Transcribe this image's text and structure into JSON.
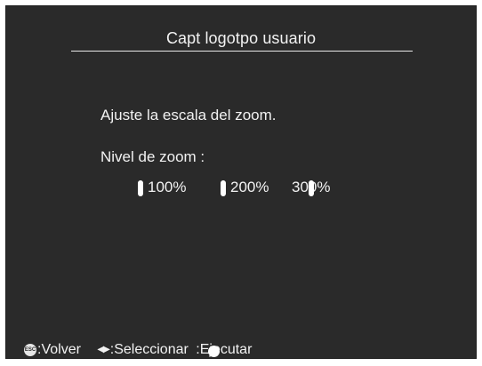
{
  "title": "Capt logotpo usuario",
  "instruction": "Ajuste la escala del zoom.",
  "zoom_label": "Nivel de zoom :",
  "options": [
    {
      "label": "100%"
    },
    {
      "label": "200%"
    },
    {
      "label": "300%"
    }
  ],
  "footer": {
    "back_icon_text": "ESC",
    "back_label": ":Volver",
    "select_icon": "left-right-arrows-icon",
    "select_label": ":Seleccionar",
    "execute_label": ":Ejecutar",
    "execute_icon": "enter-button-icon"
  },
  "colors": {
    "background": "#2a2a2a",
    "text": "#f2f2f2"
  }
}
